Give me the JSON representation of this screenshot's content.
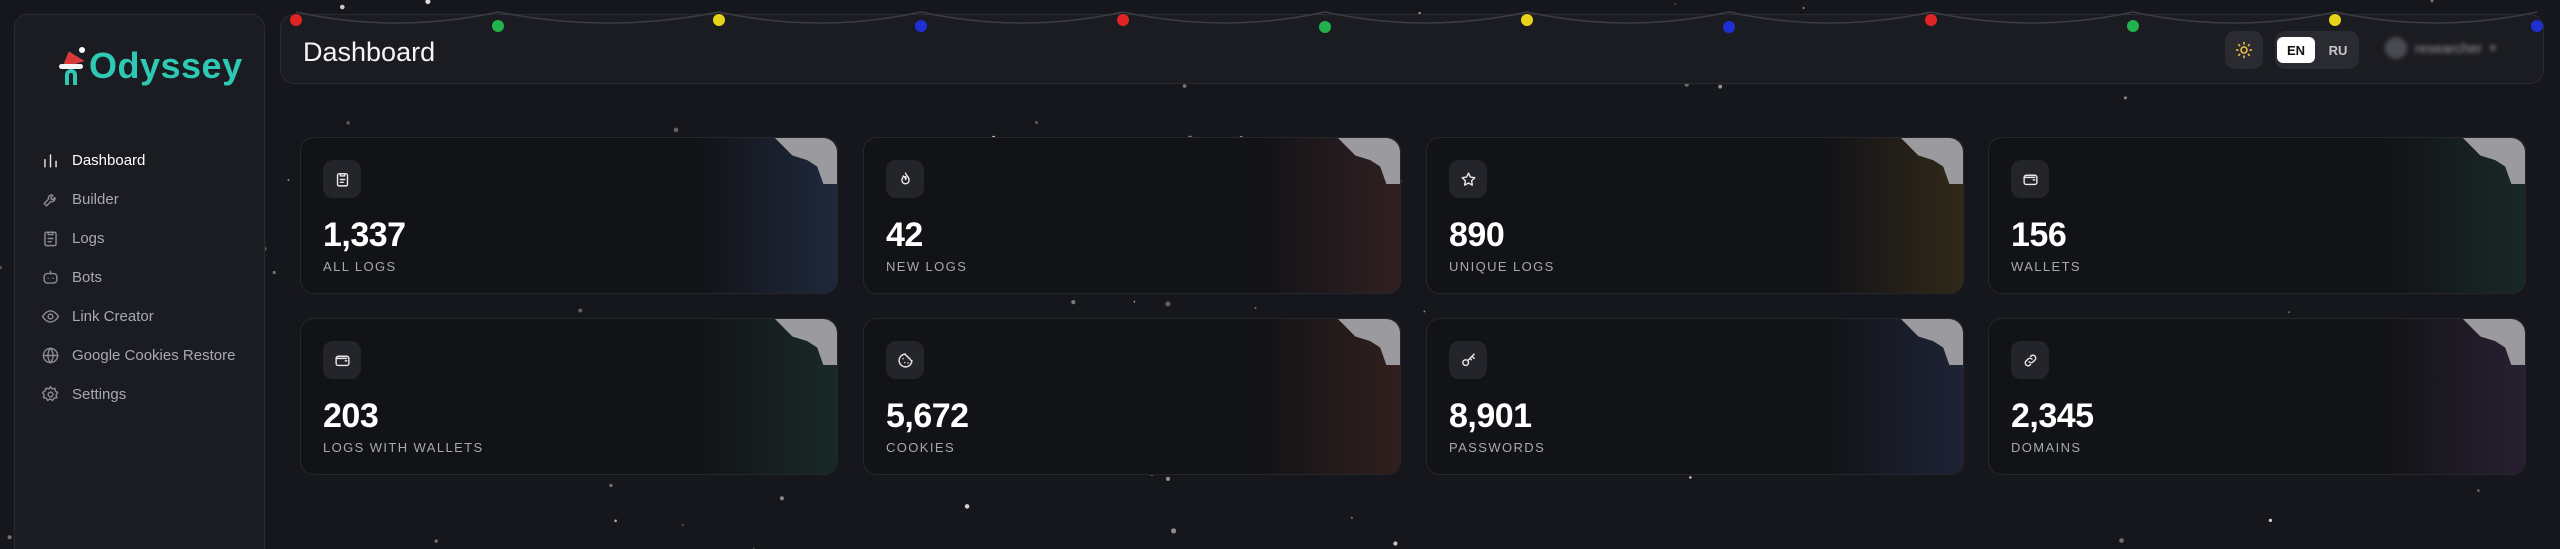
{
  "app": {
    "name": "Odyssey"
  },
  "sidebar": {
    "items": [
      {
        "label": "Dashboard",
        "icon": "bar-chart-icon",
        "active": true
      },
      {
        "label": "Builder",
        "icon": "wrench-icon",
        "active": false
      },
      {
        "label": "Logs",
        "icon": "clipboard-icon",
        "active": false
      },
      {
        "label": "Bots",
        "icon": "bot-icon",
        "active": false
      },
      {
        "label": "Link Creator",
        "icon": "eye-icon",
        "active": false
      },
      {
        "label": "Google Cookies Restore",
        "icon": "globe-icon",
        "active": false
      },
      {
        "label": "Settings",
        "icon": "gear-icon",
        "active": false
      }
    ]
  },
  "header": {
    "title": "Dashboard",
    "theme_icon": "sun-icon",
    "lang": {
      "options": [
        "EN",
        "RU"
      ],
      "selected": "EN"
    },
    "user": {
      "name": "researcher"
    }
  },
  "stats": [
    {
      "value": "1,337",
      "label": "ALL LOGS",
      "icon": "clipboard-icon",
      "tint": "#2a3a5a"
    },
    {
      "value": "42",
      "label": "NEW LOGS",
      "icon": "flame-icon",
      "tint": "#4a2a2a"
    },
    {
      "value": "890",
      "label": "UNIQUE LOGS",
      "icon": "star-icon",
      "tint": "#4a3a1a"
    },
    {
      "value": "156",
      "label": "WALLETS",
      "icon": "wallet-icon",
      "tint": "#1e3a30"
    },
    {
      "value": "203",
      "label": "LOGS WITH WALLETS",
      "icon": "wallet-icon",
      "tint": "#1e3a36"
    },
    {
      "value": "5,672",
      "label": "COOKIES",
      "icon": "cookie-icon",
      "tint": "#4a2a22"
    },
    {
      "value": "8,901",
      "label": "PASSWORDS",
      "icon": "key-icon",
      "tint": "#283050"
    },
    {
      "value": "2,345",
      "label": "DOMAINS",
      "icon": "link-icon",
      "tint": "#3a2a44"
    }
  ],
  "colors": {
    "accent": "#2ec9b4",
    "background": "#16171c",
    "garland": [
      "#e02424",
      "#22b24c",
      "#e8d31a",
      "#1f2fd6"
    ]
  }
}
